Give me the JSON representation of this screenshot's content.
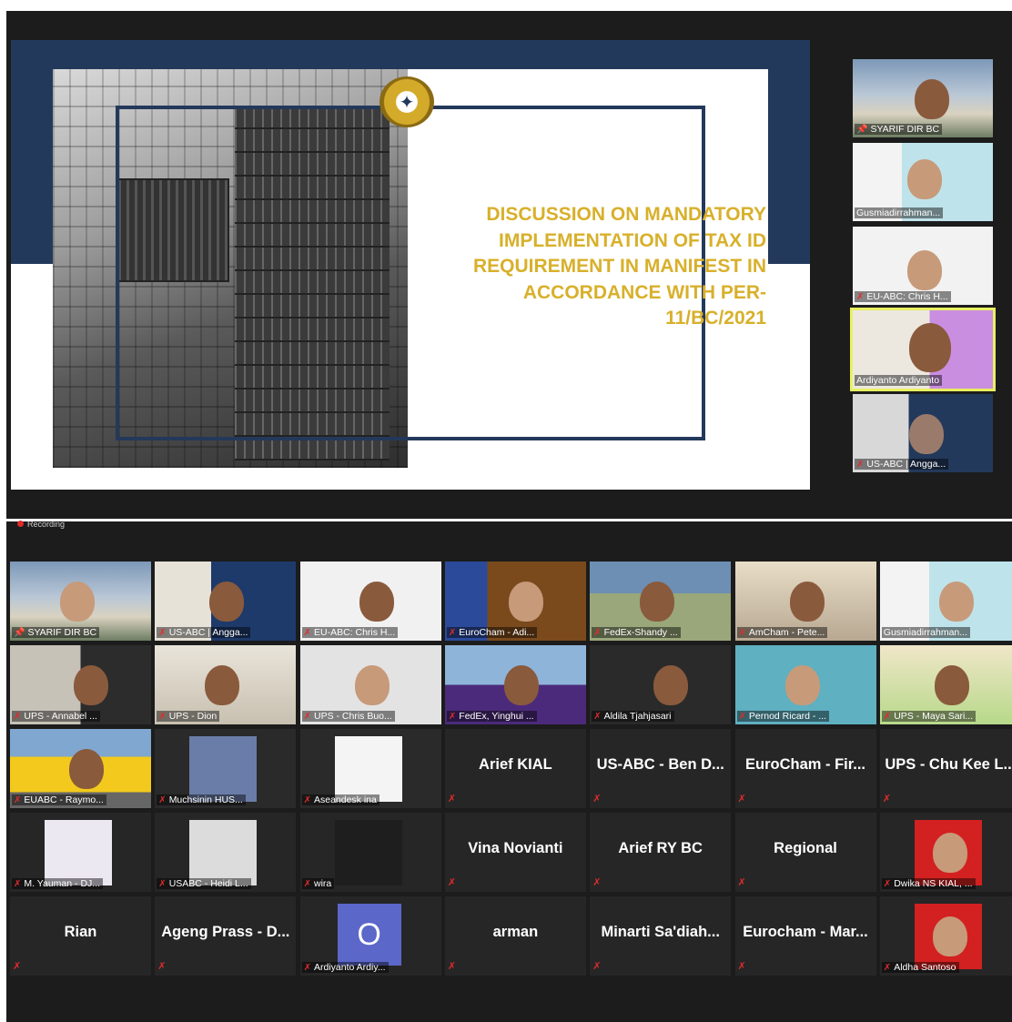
{
  "slide": {
    "title": "DISCUSSION ON MANDATORY IMPLEMENTATION OF TAX ID REQUIREMENT IN MANIFEST IN ACCORDANCE WITH PER-11/BC/2021"
  },
  "side_participants": [
    {
      "name": "SYARIF DIR BC",
      "icon": "pin-icon",
      "active": false
    },
    {
      "name": "Gusmiadirrahman...",
      "icon": "",
      "active": false
    },
    {
      "name": "EU-ABC: Chris H...",
      "icon": "mic-muted-icon",
      "active": false
    },
    {
      "name": "Ardiyanto Ardiyanto",
      "icon": "",
      "active": true
    },
    {
      "name": "US-ABC | Angga...",
      "icon": "mic-muted-icon",
      "active": false
    }
  ],
  "recording": {
    "label": "Recording"
  },
  "gallery": [
    {
      "name": "SYARIF DIR BC",
      "video": true,
      "pinned": true
    },
    {
      "name": "US-ABC | Angga...",
      "video": true
    },
    {
      "name": "EU-ABC: Chris H...",
      "video": true
    },
    {
      "name": "EuroCham - Adi...",
      "video": true
    },
    {
      "name": "FedEx-Shandy ...",
      "video": true
    },
    {
      "name": "AmCham - Pete...",
      "video": true
    },
    {
      "name": "Gusmiadirrahman...",
      "video": true
    },
    {
      "name": "UPS - Annabel ...",
      "video": true
    },
    {
      "name": "UPS - Dion",
      "video": true
    },
    {
      "name": "UPS - Chris Buo...",
      "video": true
    },
    {
      "name": "FedEx, Yinghui ...",
      "video": true
    },
    {
      "name": "Aldila Tjahjasari",
      "video": true
    },
    {
      "name": "Pernod Ricard - ...",
      "video": true
    },
    {
      "name": "UPS - Maya Sari...",
      "video": true
    },
    {
      "name": "EUABC - Raymo...",
      "video": true
    },
    {
      "name": "Muchsinin HUS...",
      "video": true
    },
    {
      "name": "Aseandesk ina",
      "video": true
    },
    {
      "name": "Arief KIAL",
      "video": false
    },
    {
      "name": "US-ABC - Ben D...",
      "video": false
    },
    {
      "name": "EuroCham - Fir...",
      "video": false
    },
    {
      "name": "UPS - Chu Kee L...",
      "video": false
    },
    {
      "name": "M. Yauman - DJ...",
      "video": true
    },
    {
      "name": "USABC - Heidi L...",
      "video": true
    },
    {
      "name": "wira",
      "video": true
    },
    {
      "name": "Vina Novianti",
      "video": false
    },
    {
      "name": "Arief RY BC",
      "video": false
    },
    {
      "name": "Regional",
      "video": false
    },
    {
      "name": "Dwika NS KIAL, ...",
      "video": true
    },
    {
      "name": "Rian",
      "video": false
    },
    {
      "name": "Ageng Prass - D...",
      "video": false
    },
    {
      "name": "Ardiyanto Ardiy...",
      "video": true,
      "avatar_letter": "O"
    },
    {
      "name": "arman",
      "video": false
    },
    {
      "name": "Minarti Sa'diah...",
      "video": false
    },
    {
      "name": "Eurocham - Mar...",
      "video": false
    },
    {
      "name": "Aldha Santoso",
      "video": true
    }
  ],
  "colors": {
    "slide_band": "#23395b",
    "slide_title": "#d8b02b",
    "active_speaker": "#e8f060",
    "muted": "#e02b2b",
    "panel_bg": "#1c1c1c"
  }
}
